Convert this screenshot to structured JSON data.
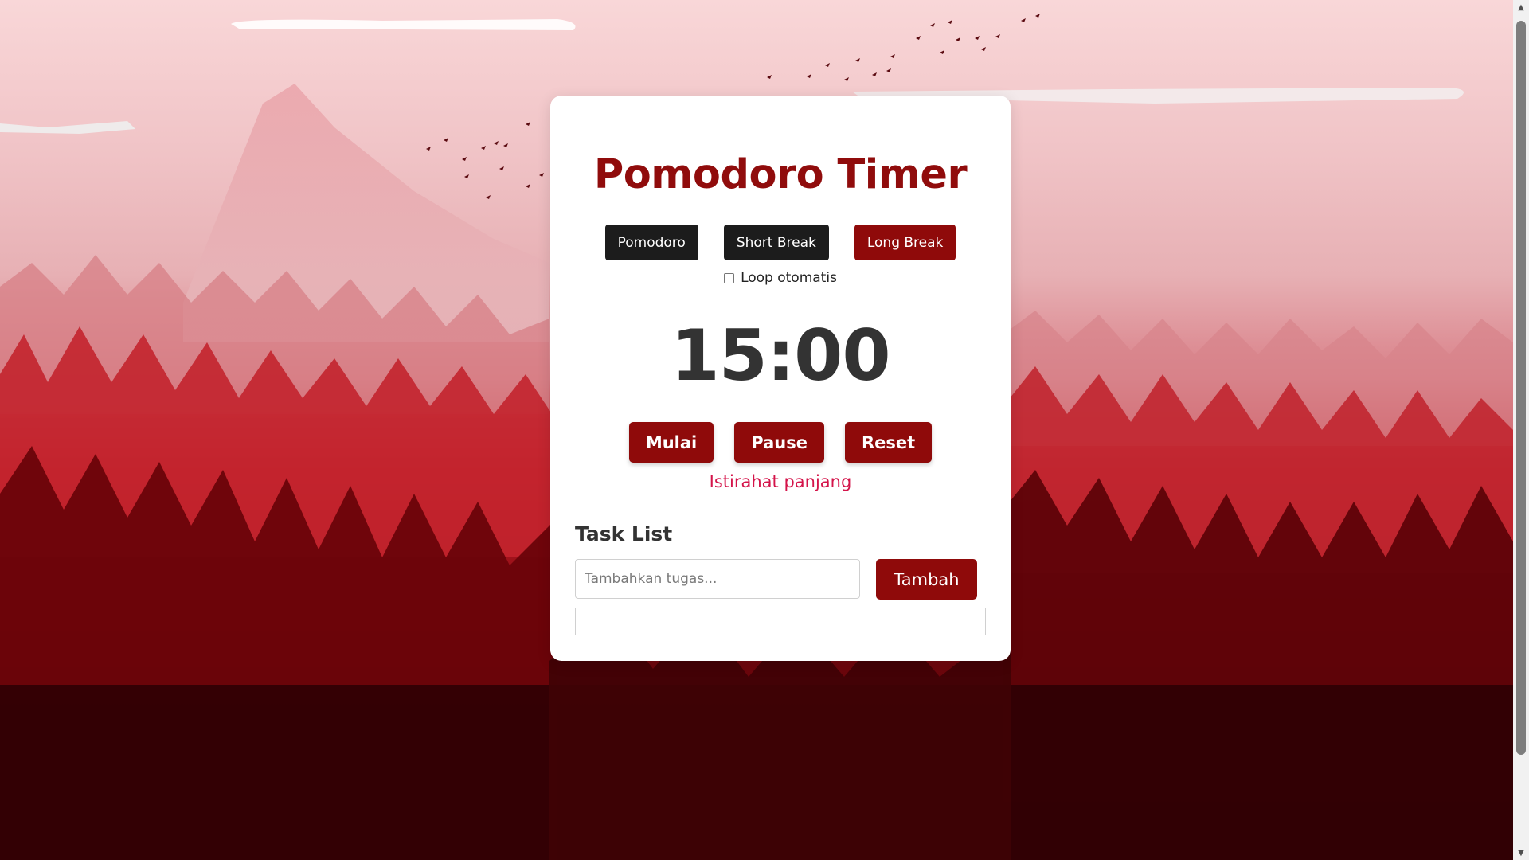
{
  "app": {
    "title": "Pomodoro Timer"
  },
  "modes": [
    {
      "label": "Pomodoro",
      "style": "dark"
    },
    {
      "label": "Short Break",
      "style": "dark"
    },
    {
      "label": "Long Break",
      "style": "red"
    }
  ],
  "loop": {
    "label": "Loop otomatis",
    "checked": false
  },
  "timer": {
    "display": "15:00"
  },
  "controls": {
    "start_label": "Mulai",
    "pause_label": "Pause",
    "reset_label": "Reset"
  },
  "status": {
    "text": "Istirahat panjang"
  },
  "tasks": {
    "heading": "Task List",
    "input_value": "",
    "input_placeholder": "Tambahkan tugas...",
    "add_label": "Tambah",
    "items": []
  },
  "colors": {
    "accent": "#8f0a0a",
    "title": "#900c0c",
    "dark_button": "#1c1c1c",
    "status_text": "#d4144a",
    "timer_text": "#333333"
  },
  "icons": {
    "scroll_up": "scroll-up-arrow-icon",
    "scroll_down": "scroll-down-arrow-icon"
  }
}
